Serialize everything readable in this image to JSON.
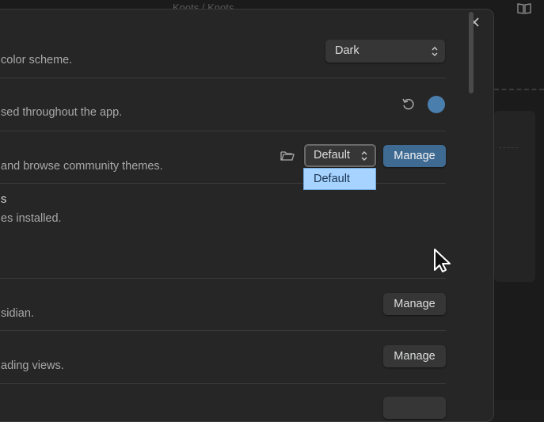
{
  "background": {
    "breadcrumb": "Knots / Knots"
  },
  "settings": {
    "base_color_scheme": {
      "description": "color scheme.",
      "selected": "Dark"
    },
    "accent_color": {
      "description": "sed throughout the app.",
      "swatch_color": "#4a7ead"
    },
    "themes": {
      "description": "and browse community themes.",
      "selected": "Default",
      "manage_label": "Manage",
      "dropdown_options": [
        "Default"
      ]
    },
    "css_snippets": {
      "title": "s",
      "description": "es installed."
    },
    "row_fonts": {
      "description": "sidian.",
      "manage_label": "Manage"
    },
    "row_reading": {
      "description": "ading views.",
      "manage_label": "Manage"
    }
  },
  "colors": {
    "accent": "#3f6b93",
    "dropdown_highlight": "#a6d3ff"
  }
}
